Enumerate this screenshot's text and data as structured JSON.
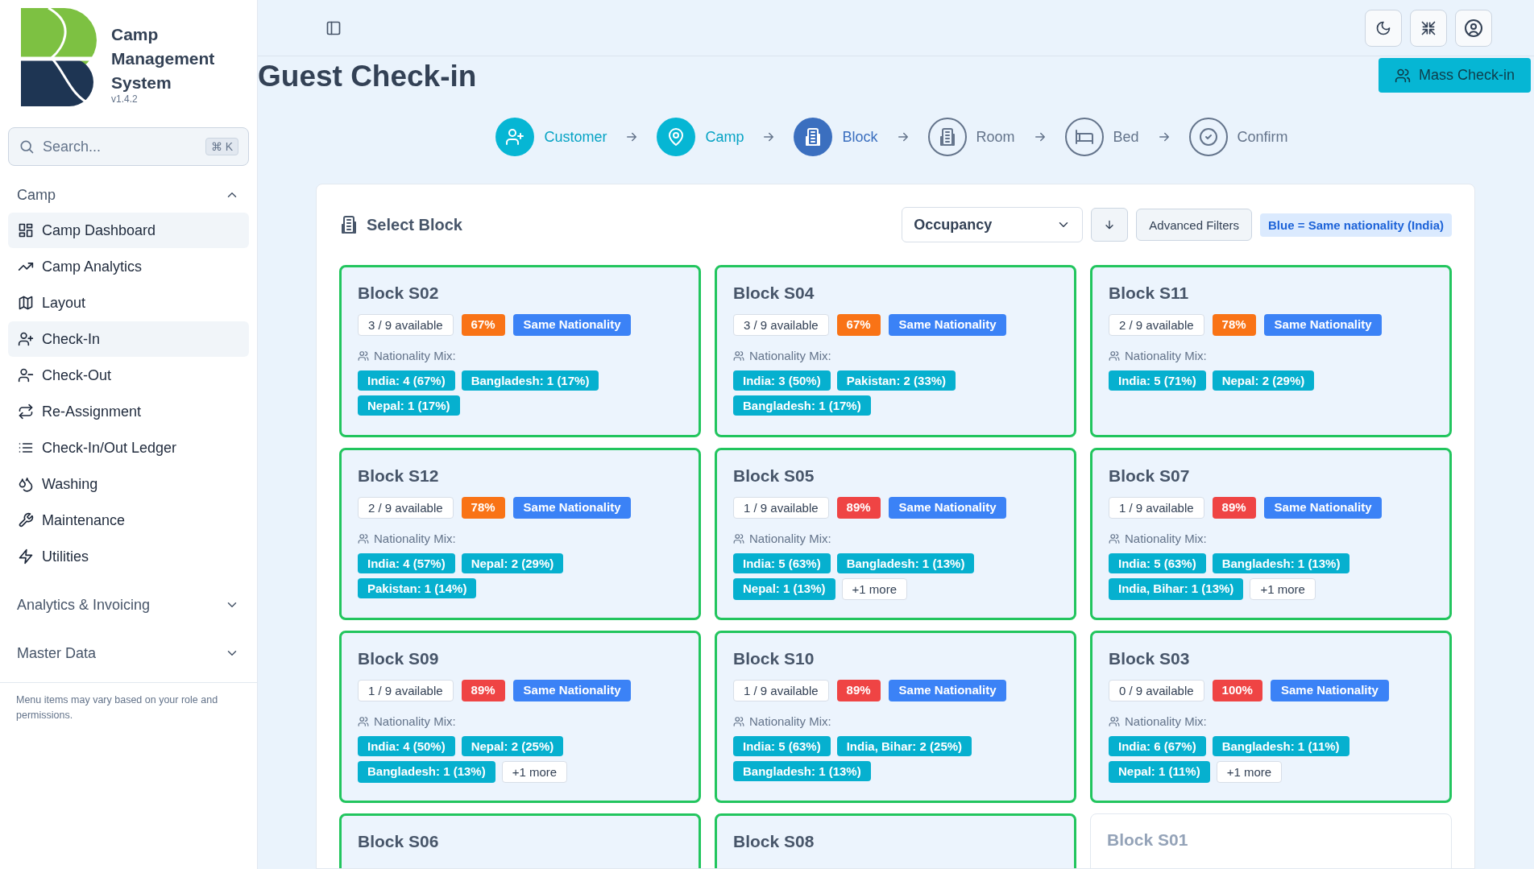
{
  "brand": {
    "name": "Camp Management System",
    "version": "v1.4.2"
  },
  "search": {
    "placeholder": "Search...",
    "shortcut": "⌘ K"
  },
  "nav_sections": [
    {
      "title": "Camp",
      "expanded": true,
      "items": [
        {
          "label": "Camp Dashboard",
          "selected": true
        },
        {
          "label": "Camp Analytics",
          "selected": false
        },
        {
          "label": "Layout",
          "selected": false
        },
        {
          "label": "Check-In",
          "selected": true
        },
        {
          "label": "Check-Out",
          "selected": false
        },
        {
          "label": "Re-Assignment",
          "selected": false
        },
        {
          "label": "Check-In/Out Ledger",
          "selected": false
        },
        {
          "label": "Washing",
          "selected": false
        },
        {
          "label": "Maintenance",
          "selected": false
        },
        {
          "label": "Utilities",
          "selected": false
        }
      ]
    },
    {
      "title": "Analytics & Invoicing",
      "expanded": false
    },
    {
      "title": "Master Data",
      "expanded": false
    }
  ],
  "sidebar_note": "Menu items may vary based on your role and permissions.",
  "page_title": "Guest Check-in",
  "mass_checkin_button": "Mass Check-in",
  "steps": [
    {
      "label": "Customer",
      "kind": "done"
    },
    {
      "label": "Camp",
      "kind": "done"
    },
    {
      "label": "Block",
      "kind": "current"
    },
    {
      "label": "Room",
      "kind": "pending"
    },
    {
      "label": "Bed",
      "kind": "pending"
    },
    {
      "label": "Confirm",
      "kind": "pending"
    }
  ],
  "panel": {
    "title": "Select Block",
    "sort_select": "Occupancy",
    "filters_button": "Advanced Filters",
    "legend": "Blue = Same nationality (India)",
    "blocks": [
      {
        "name": "Block S02",
        "available": "3 / 9 available",
        "occupancy": "67%",
        "color": "#f97316",
        "badge": "Same Nationality",
        "highlighted": true,
        "mix_label": "Nationality Mix:",
        "mix": [
          {
            "kind": "nationality",
            "text": "India: 4 (67%)"
          },
          {
            "kind": "nationality",
            "text": "Bangladesh: 1 (17%)"
          },
          {
            "kind": "nationality",
            "text": "Nepal: 1 (17%)"
          }
        ]
      },
      {
        "name": "Block S04",
        "available": "3 / 9 available",
        "occupancy": "67%",
        "color": "#f97316",
        "badge": "Same Nationality",
        "highlighted": true,
        "mix_label": "Nationality Mix:",
        "mix": [
          {
            "kind": "nationality",
            "text": "India: 3 (50%)"
          },
          {
            "kind": "nationality",
            "text": "Pakistan: 2 (33%)"
          },
          {
            "kind": "nationality",
            "text": "Bangladesh: 1 (17%)"
          }
        ]
      },
      {
        "name": "Block S11",
        "available": "2 / 9 available",
        "occupancy": "78%",
        "color": "#f97316",
        "badge": "Same Nationality",
        "highlighted": true,
        "mix_label": "Nationality Mix:",
        "mix": [
          {
            "kind": "nationality",
            "text": "India: 5 (71%)"
          },
          {
            "kind": "nationality",
            "text": "Nepal: 2 (29%)"
          }
        ]
      },
      {
        "name": "Block S12",
        "available": "2 / 9 available",
        "occupancy": "78%",
        "color": "#f97316",
        "badge": "Same Nationality",
        "highlighted": true,
        "mix_label": "Nationality Mix:",
        "mix": [
          {
            "kind": "nationality",
            "text": "India: 4 (57%)"
          },
          {
            "kind": "nationality",
            "text": "Nepal: 2 (29%)"
          },
          {
            "kind": "nationality",
            "text": "Pakistan: 1 (14%)"
          }
        ]
      },
      {
        "name": "Block S05",
        "available": "1 / 9 available",
        "occupancy": "89%",
        "color": "#ef4444",
        "badge": "Same Nationality",
        "highlighted": true,
        "mix_label": "Nationality Mix:",
        "mix": [
          {
            "kind": "nationality",
            "text": "India: 5 (63%)"
          },
          {
            "kind": "nationality",
            "text": "Bangladesh: 1 (13%)"
          },
          {
            "kind": "nationality",
            "text": "Nepal: 1 (13%)"
          },
          {
            "kind": "more",
            "text": "+1 more"
          }
        ]
      },
      {
        "name": "Block S07",
        "available": "1 / 9 available",
        "occupancy": "89%",
        "color": "#ef4444",
        "badge": "Same Nationality",
        "highlighted": true,
        "mix_label": "Nationality Mix:",
        "mix": [
          {
            "kind": "nationality",
            "text": "India: 5 (63%)"
          },
          {
            "kind": "nationality",
            "text": "Bangladesh: 1 (13%)"
          },
          {
            "kind": "nationality",
            "text": "India, Bihar: 1 (13%)"
          },
          {
            "kind": "more",
            "text": "+1 more"
          }
        ]
      },
      {
        "name": "Block S09",
        "available": "1 / 9 available",
        "occupancy": "89%",
        "color": "#ef4444",
        "badge": "Same Nationality",
        "highlighted": true,
        "mix_label": "Nationality Mix:",
        "mix": [
          {
            "kind": "nationality",
            "text": "India: 4 (50%)"
          },
          {
            "kind": "nationality",
            "text": "Nepal: 2 (25%)"
          },
          {
            "kind": "nationality",
            "text": "Bangladesh: 1 (13%)"
          },
          {
            "kind": "more",
            "text": "+1 more"
          }
        ]
      },
      {
        "name": "Block S10",
        "available": "1 / 9 available",
        "occupancy": "89%",
        "color": "#ef4444",
        "badge": "Same Nationality",
        "highlighted": true,
        "mix_label": "Nationality Mix:",
        "mix": [
          {
            "kind": "nationality",
            "text": "India: 5 (63%)"
          },
          {
            "kind": "nationality",
            "text": "India, Bihar: 2 (25%)"
          },
          {
            "kind": "nationality",
            "text": "Bangladesh: 1 (13%)"
          }
        ]
      },
      {
        "name": "Block S03",
        "available": "0 / 9 available",
        "occupancy": "100%",
        "color": "#ef4444",
        "badge": "Same Nationality",
        "highlighted": true,
        "mix_label": "Nationality Mix:",
        "mix": [
          {
            "kind": "nationality",
            "text": "India: 6 (67%)"
          },
          {
            "kind": "nationality",
            "text": "Bangladesh: 1 (11%)"
          },
          {
            "kind": "nationality",
            "text": "Nepal: 1 (11%)"
          },
          {
            "kind": "more",
            "text": "+1 more"
          }
        ]
      },
      {
        "name": "Block S06",
        "highlighted": true
      },
      {
        "name": "Block S08",
        "highlighted": true
      },
      {
        "name": "Block S01",
        "highlighted": false
      }
    ]
  }
}
